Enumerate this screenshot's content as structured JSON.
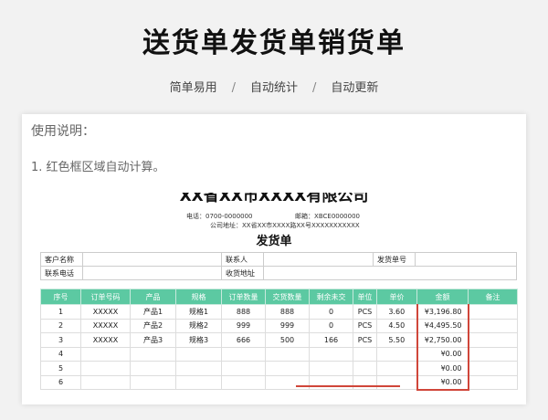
{
  "page": {
    "title": "送货单发货单销货单",
    "features": [
      "简单易用",
      "自动统计",
      "自动更新"
    ],
    "separator": "/"
  },
  "instructions": {
    "title": "使用说明：",
    "line1": "1. 红色框区域自动计算。"
  },
  "document": {
    "company": "XX省XX市XXXX有限公司",
    "tel": "电话：0700-0000000",
    "email": "邮箱：XBCE0000000",
    "address": "公司地址：XX省XX市XXXX路XX号XXXXXXXXXXX",
    "doc_title": "发货单",
    "info": {
      "customer_label": "客户名称",
      "contact_label": "联系人",
      "order_no_label": "发货单号",
      "phone_label": "联系电话",
      "delivery_addr_label": "收货地址"
    },
    "columns": [
      "序号",
      "订单号码",
      "产品",
      "规格",
      "订单数量",
      "交货数量",
      "剩余未交",
      "单位",
      "单价",
      "金额",
      "备注"
    ],
    "rows": [
      [
        "1",
        "XXXXX",
        "产品1",
        "规格1",
        "888",
        "888",
        "0",
        "PCS",
        "3.60",
        "¥3,196.80",
        ""
      ],
      [
        "2",
        "XXXXX",
        "产品2",
        "规格2",
        "999",
        "999",
        "0",
        "PCS",
        "4.50",
        "¥4,495.50",
        ""
      ],
      [
        "3",
        "XXXXX",
        "产品3",
        "规格3",
        "666",
        "500",
        "166",
        "PCS",
        "5.50",
        "¥2,750.00",
        ""
      ],
      [
        "4",
        "",
        "",
        "",
        "",
        "",
        "",
        "",
        "",
        "¥0.00",
        ""
      ],
      [
        "5",
        "",
        "",
        "",
        "",
        "",
        "",
        "",
        "",
        "¥0.00",
        ""
      ],
      [
        "6",
        "",
        "",
        "",
        "",
        "",
        "",
        "",
        "",
        "¥0.00",
        ""
      ]
    ]
  },
  "colors": {
    "header_green": "#5cc9a2",
    "highlight_red": "#d0463a"
  }
}
